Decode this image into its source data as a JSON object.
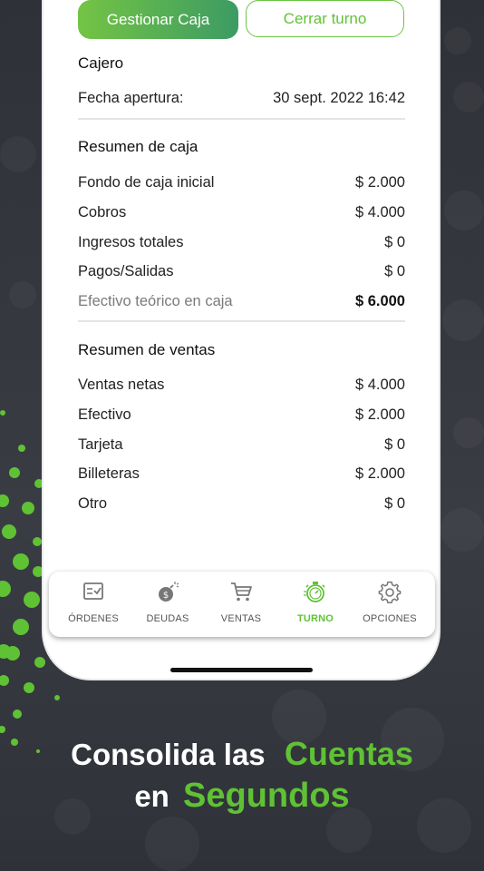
{
  "colors": {
    "accent": "#5fc234",
    "background": "#32343b"
  },
  "actions": {
    "gestionar": "Gestionar Caja",
    "cerrar": "Cerrar turno"
  },
  "cajero": {
    "title": "Cajero",
    "fecha_label": "Fecha apertura:",
    "fecha_value": "30 sept. 2022 16:42"
  },
  "resumen_caja": {
    "title": "Resumen de caja",
    "rows": [
      {
        "label": "Fondo de caja inicial",
        "value": "$ 2.000"
      },
      {
        "label": "Cobros",
        "value": "$ 4.000"
      },
      {
        "label": "Ingresos totales",
        "value": "$ 0"
      },
      {
        "label": "Pagos/Salidas",
        "value": "$ 0"
      },
      {
        "label": "Efectivo teórico en caja",
        "value": "$ 6.000"
      }
    ]
  },
  "resumen_ventas": {
    "title": "Resumen de ventas",
    "rows": [
      {
        "label": "Ventas netas",
        "value": "$ 4.000"
      },
      {
        "label": "Efectivo",
        "value": "$ 2.000"
      },
      {
        "label": "Tarjeta",
        "value": "$ 0"
      },
      {
        "label": "Billeteras",
        "value": "$ 2.000"
      },
      {
        "label": "Otro",
        "value": "$ 0"
      }
    ]
  },
  "tabs": [
    {
      "label": "ÓRDENES",
      "icon": "orders-icon"
    },
    {
      "label": "DEUDAS",
      "icon": "debt-bomb-icon"
    },
    {
      "label": "VENTAS",
      "icon": "cart-icon"
    },
    {
      "label": "TURNO",
      "icon": "stopwatch-icon",
      "active": true
    },
    {
      "label": "OPCIONES",
      "icon": "gear-icon"
    }
  ],
  "headline": {
    "line1_white": "Consolida las",
    "line1_green": "Cuentas",
    "line2_white": "en",
    "line2_green": "Segundos"
  }
}
